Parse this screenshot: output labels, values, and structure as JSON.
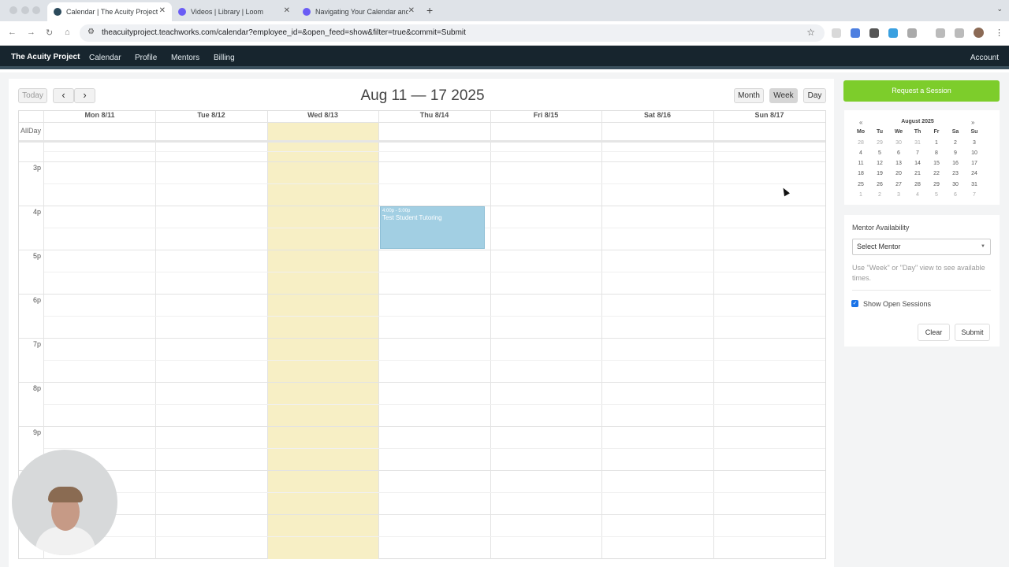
{
  "browser": {
    "tabs": [
      {
        "title": "Calendar | The Acuity Project",
        "active": true
      },
      {
        "title": "Videos | Library | Loom",
        "active": false
      },
      {
        "title": "Navigating Your Calendar and",
        "active": false
      }
    ],
    "url": "theacuityproject.teachworks.com/calendar?employee_id=&open_feed=show&filter=true&commit=Submit"
  },
  "navbar": {
    "brand": "The Acuity Project",
    "links": [
      "Calendar",
      "Profile",
      "Mentors",
      "Billing"
    ],
    "account": "Account"
  },
  "calendar": {
    "today_label": "Today",
    "prev_label": "‹",
    "next_label": "›",
    "title": "Aug 11 — 17 2025",
    "views": [
      "Month",
      "Week",
      "Day"
    ],
    "active_view": "Week",
    "days": [
      "Mon 8/11",
      "Tue 8/12",
      "Wed 8/13",
      "Thu 8/14",
      "Fri 8/15",
      "Sat 8/16",
      "Sun 8/17"
    ],
    "allday_label": "AllDay",
    "hours": [
      "3p",
      "4p",
      "5p",
      "6p",
      "7p",
      "8p",
      "9p"
    ],
    "event": {
      "time": "4:00p - 5:00p",
      "title": "Test Student Tutoring",
      "color": "#a2cfe3"
    },
    "today_highlight_color": "#f7efc5"
  },
  "sidebar": {
    "request_button": "Request a Session",
    "request_color": "#7dcd2b",
    "mini_calendar": {
      "prev": "«",
      "next": "»",
      "title": "August 2025",
      "weekdays": [
        "Mo",
        "Tu",
        "We",
        "Th",
        "Fr",
        "Sa",
        "Su"
      ],
      "weeks": [
        [
          "28",
          "29",
          "30",
          "31",
          "1",
          "2",
          "3"
        ],
        [
          "4",
          "5",
          "6",
          "7",
          "8",
          "9",
          "10"
        ],
        [
          "11",
          "12",
          "13",
          "14",
          "15",
          "16",
          "17"
        ],
        [
          "18",
          "19",
          "20",
          "21",
          "22",
          "23",
          "24"
        ],
        [
          "25",
          "26",
          "27",
          "28",
          "29",
          "30",
          "31"
        ],
        [
          "1",
          "2",
          "3",
          "4",
          "5",
          "6",
          "7"
        ]
      ]
    },
    "mentor_label": "Mentor Availability",
    "mentor_select": "Select Mentor",
    "help_text": "Use \"Week\" or \"Day\" view to see available times.",
    "show_open_label": "Show Open Sessions",
    "show_open_checked": true,
    "clear_label": "Clear",
    "submit_label": "Submit"
  }
}
